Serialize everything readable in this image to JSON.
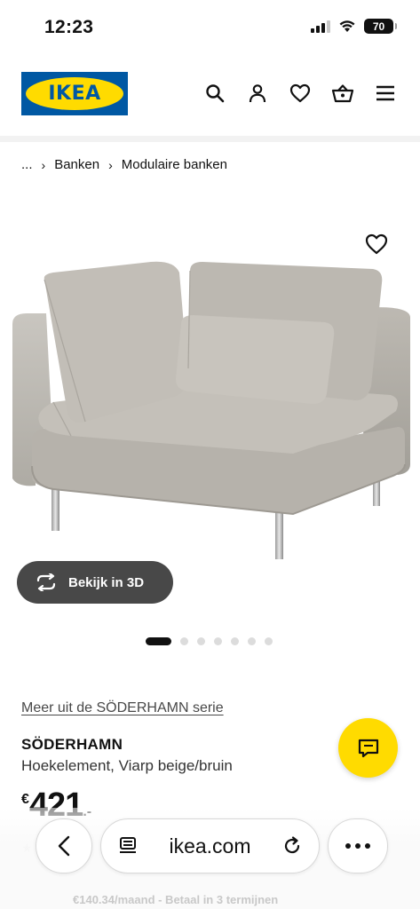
{
  "status_bar": {
    "time": "12:23",
    "battery": "70"
  },
  "header": {
    "logo_text": "IKEA",
    "icons": [
      "search-icon",
      "account-icon",
      "wishlist-icon",
      "basket-icon",
      "menu-icon"
    ]
  },
  "breadcrumb": {
    "items": [
      "...",
      "Banken",
      "Modulaire banken"
    ]
  },
  "gallery": {
    "view_3d_label": "Bekijk in 3D",
    "dot_count": 7,
    "active_dot": 1
  },
  "product": {
    "series_link": "Meer uit de SÖDERHAMN serie",
    "name": "SÖDERHAMN",
    "description": "Hoekelement, Viarp beige/bruin",
    "price_currency": "€",
    "price_amount": "421",
    "price_decimals": ".-",
    "installment_text": "€140.34/maand - Betaal in 3 termijnen"
  },
  "browser": {
    "url": "ikea.com"
  },
  "colors": {
    "ikea_blue": "#0058a3",
    "ikea_yellow": "#ffdb00",
    "dark_button": "#484848"
  }
}
